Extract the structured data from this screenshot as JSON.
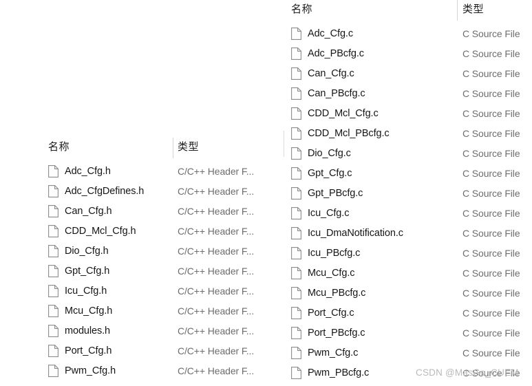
{
  "watermark": "CSDN @MasGo_CUEM",
  "panes": [
    {
      "id": "headers",
      "columns": {
        "name": "名称",
        "type": "类型"
      },
      "rows": [
        {
          "name": "Adc_Cfg.h",
          "type": "C/C++ Header F...",
          "icon": "file-icon"
        },
        {
          "name": "Adc_CfgDefines.h",
          "type": "C/C++ Header F...",
          "icon": "file-icon"
        },
        {
          "name": "Can_Cfg.h",
          "type": "C/C++ Header F...",
          "icon": "file-icon"
        },
        {
          "name": "CDD_Mcl_Cfg.h",
          "type": "C/C++ Header F...",
          "icon": "file-icon"
        },
        {
          "name": "Dio_Cfg.h",
          "type": "C/C++ Header F...",
          "icon": "file-icon"
        },
        {
          "name": "Gpt_Cfg.h",
          "type": "C/C++ Header F...",
          "icon": "file-icon"
        },
        {
          "name": "Icu_Cfg.h",
          "type": "C/C++ Header F...",
          "icon": "file-icon"
        },
        {
          "name": "Mcu_Cfg.h",
          "type": "C/C++ Header F...",
          "icon": "file-icon"
        },
        {
          "name": "modules.h",
          "type": "C/C++ Header F...",
          "icon": "file-icon"
        },
        {
          "name": "Port_Cfg.h",
          "type": "C/C++ Header F...",
          "icon": "file-icon"
        },
        {
          "name": "Pwm_Cfg.h",
          "type": "C/C++ Header F...",
          "icon": "file-icon"
        }
      ]
    },
    {
      "id": "sources",
      "columns": {
        "name": "名称",
        "type": "类型"
      },
      "rows": [
        {
          "name": "Adc_Cfg.c",
          "type": "C Source File",
          "icon": "file-icon"
        },
        {
          "name": "Adc_PBcfg.c",
          "type": "C Source File",
          "icon": "file-icon"
        },
        {
          "name": "Can_Cfg.c",
          "type": "C Source File",
          "icon": "file-icon"
        },
        {
          "name": "Can_PBcfg.c",
          "type": "C Source File",
          "icon": "file-icon"
        },
        {
          "name": "CDD_Mcl_Cfg.c",
          "type": "C Source File",
          "icon": "file-icon"
        },
        {
          "name": "CDD_Mcl_PBcfg.c",
          "type": "C Source File",
          "icon": "file-icon"
        },
        {
          "name": "Dio_Cfg.c",
          "type": "C Source File",
          "icon": "file-icon"
        },
        {
          "name": "Gpt_Cfg.c",
          "type": "C Source File",
          "icon": "file-icon"
        },
        {
          "name": "Gpt_PBcfg.c",
          "type": "C Source File",
          "icon": "file-icon"
        },
        {
          "name": "Icu_Cfg.c",
          "type": "C Source File",
          "icon": "file-icon"
        },
        {
          "name": "Icu_DmaNotification.c",
          "type": "C Source File",
          "icon": "file-icon"
        },
        {
          "name": "Icu_PBcfg.c",
          "type": "C Source File",
          "icon": "file-icon"
        },
        {
          "name": "Mcu_Cfg.c",
          "type": "C Source File",
          "icon": "file-icon"
        },
        {
          "name": "Mcu_PBcfg.c",
          "type": "C Source File",
          "icon": "file-icon"
        },
        {
          "name": "Port_Cfg.c",
          "type": "C Source File",
          "icon": "file-icon"
        },
        {
          "name": "Port_PBcfg.c",
          "type": "C Source File",
          "icon": "file-icon"
        },
        {
          "name": "Pwm_Cfg.c",
          "type": "C Source File",
          "icon": "file-icon"
        },
        {
          "name": "Pwm_PBcfg.c",
          "type": "C Source File",
          "icon": "file-icon"
        }
      ]
    }
  ],
  "colors": {
    "background": "#ffffff",
    "name_text": "#151515",
    "type_text": "#6d6d6d",
    "divider": "#d4d4d4",
    "watermark": "#b9b9b9"
  }
}
